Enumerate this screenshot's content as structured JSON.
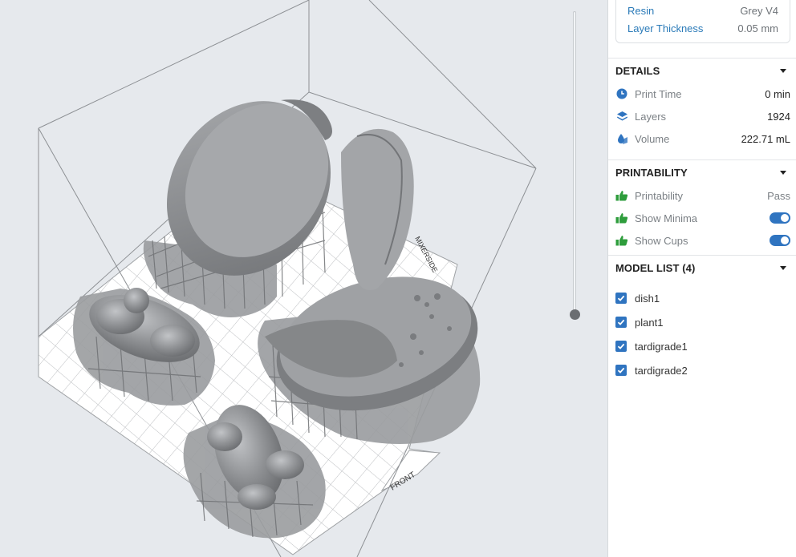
{
  "material": {
    "resin_label": "Resin",
    "resin_value": "Grey V4",
    "layer_label": "Layer Thickness",
    "layer_value": "0.05 mm"
  },
  "details": {
    "title": "DETAILS",
    "rows": [
      {
        "label": "Print Time",
        "value": "0 min",
        "icon": "clock-icon"
      },
      {
        "label": "Layers",
        "value": "1924",
        "icon": "layers-icon"
      },
      {
        "label": "Volume",
        "value": "222.71 mL",
        "icon": "resin-drop-icon"
      }
    ]
  },
  "printability": {
    "title": "PRINTABILITY",
    "rows": [
      {
        "label": "Printability",
        "value": "Pass",
        "icon": "thumbs-up-icon"
      },
      {
        "label": "Show Minima",
        "toggle": true,
        "icon": "thumbs-up-icon"
      },
      {
        "label": "Show Cups",
        "toggle": true,
        "icon": "thumbs-up-icon"
      }
    ]
  },
  "model_list": {
    "title": "MODEL LIST (4)",
    "items": [
      "dish1",
      "plant1",
      "tardigrade1",
      "tardigrade2"
    ]
  },
  "viewport": {
    "front_label": "FRONT",
    "back_label": "MIXERSIDE"
  },
  "colors": {
    "accent": "#2f74c0",
    "label_blue": "#2a7ab8",
    "icon_green": "#2e9d3c",
    "model_grey": "#8d8f92"
  }
}
